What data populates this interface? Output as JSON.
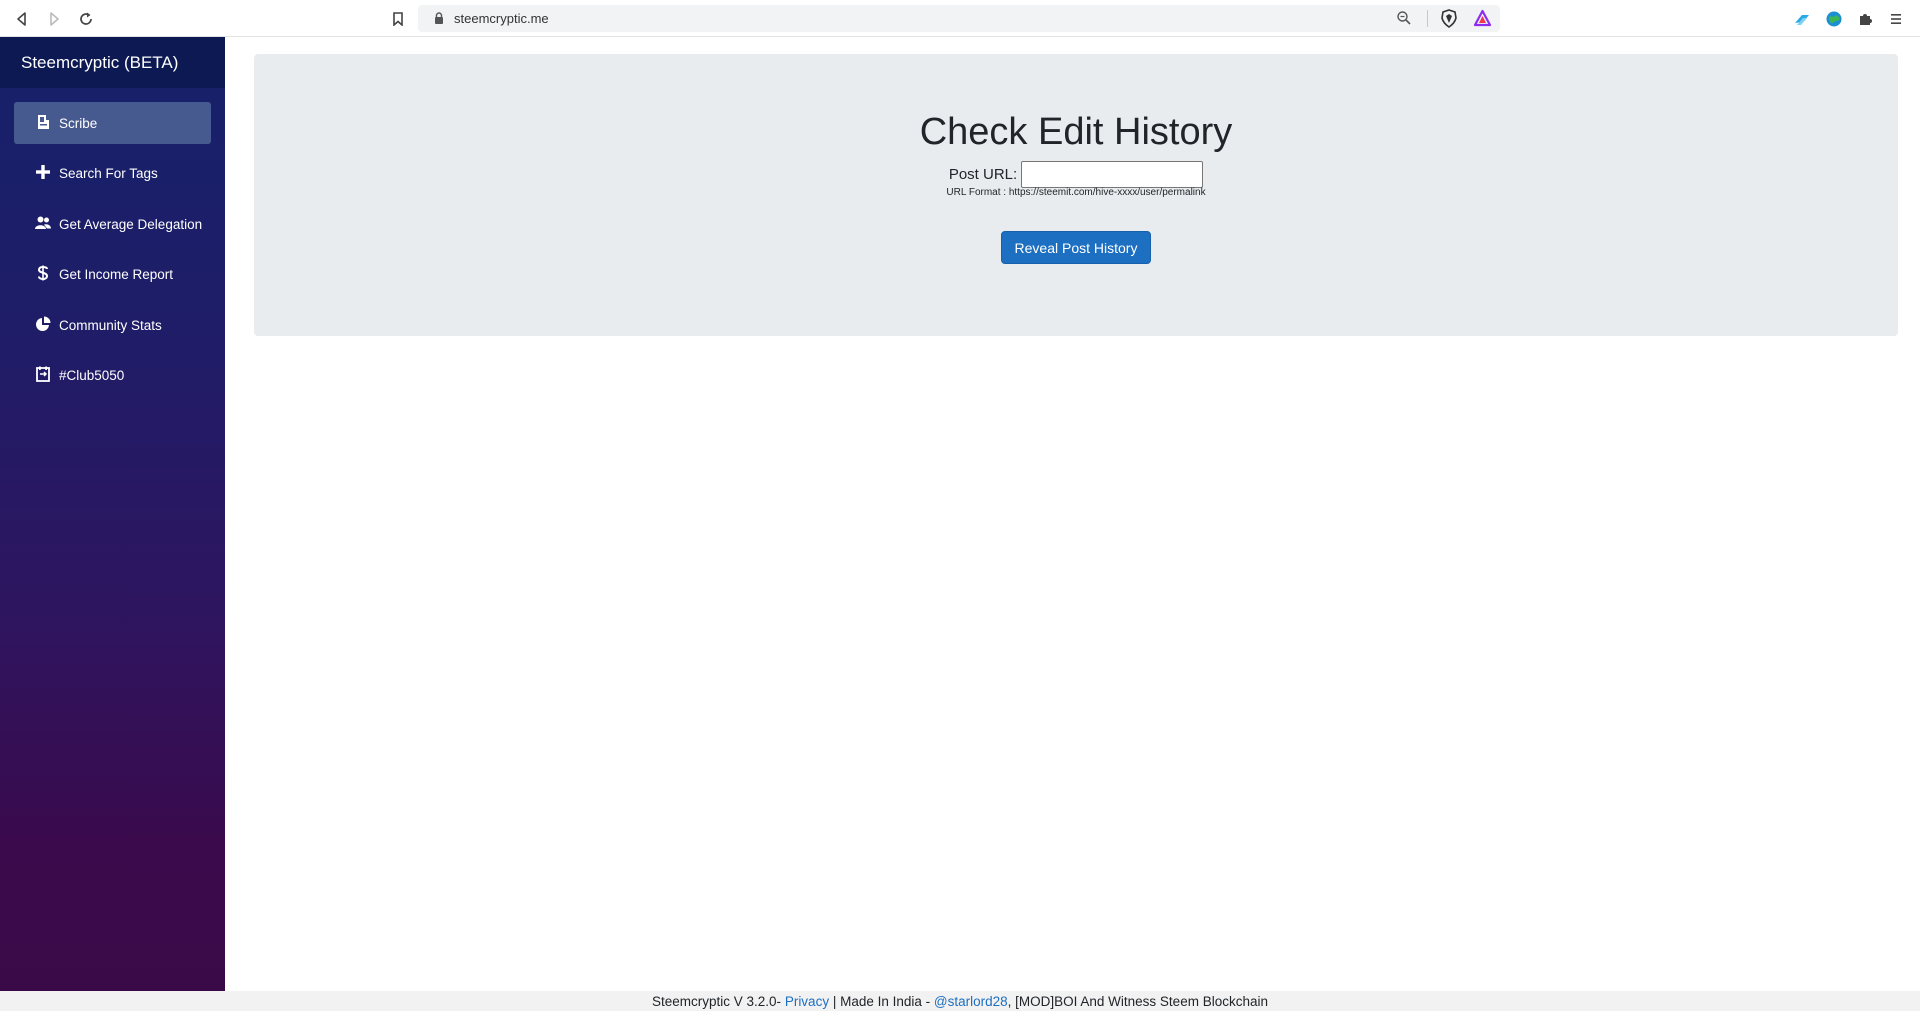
{
  "browser": {
    "url": "steemcryptic.me"
  },
  "sidebar": {
    "title": "Steemcryptic (BETA)",
    "items": [
      {
        "label": "Scribe",
        "icon": "scribe-icon"
      },
      {
        "label": "Search For Tags",
        "icon": "plus-icon"
      },
      {
        "label": "Get Average Delegation",
        "icon": "users-icon"
      },
      {
        "label": "Get Income Report",
        "icon": "dollar-icon"
      },
      {
        "label": "Community Stats",
        "icon": "pie-chart-icon"
      },
      {
        "label": "#Club5050",
        "icon": "calendar-icon"
      }
    ]
  },
  "main": {
    "title": "Check Edit History",
    "url_label": "Post URL:",
    "url_value": "",
    "url_format": "URL Format : https://steemit.com/hive-xxxx/user/permalink",
    "button_label": "Reveal Post History"
  },
  "footer": {
    "prefix": "Steemcryptic V 3.2.0- ",
    "privacy": "Privacy",
    "middle": " | Made In India - ",
    "author": "@starlord28",
    "suffix": ", [MOD]BOI And Witness Steem Blockchain"
  },
  "colors": {
    "sidebar_header": "#0c1953",
    "active_item": "#465a8f",
    "button": "#1d6fc1",
    "panel": "#e9ecef"
  }
}
